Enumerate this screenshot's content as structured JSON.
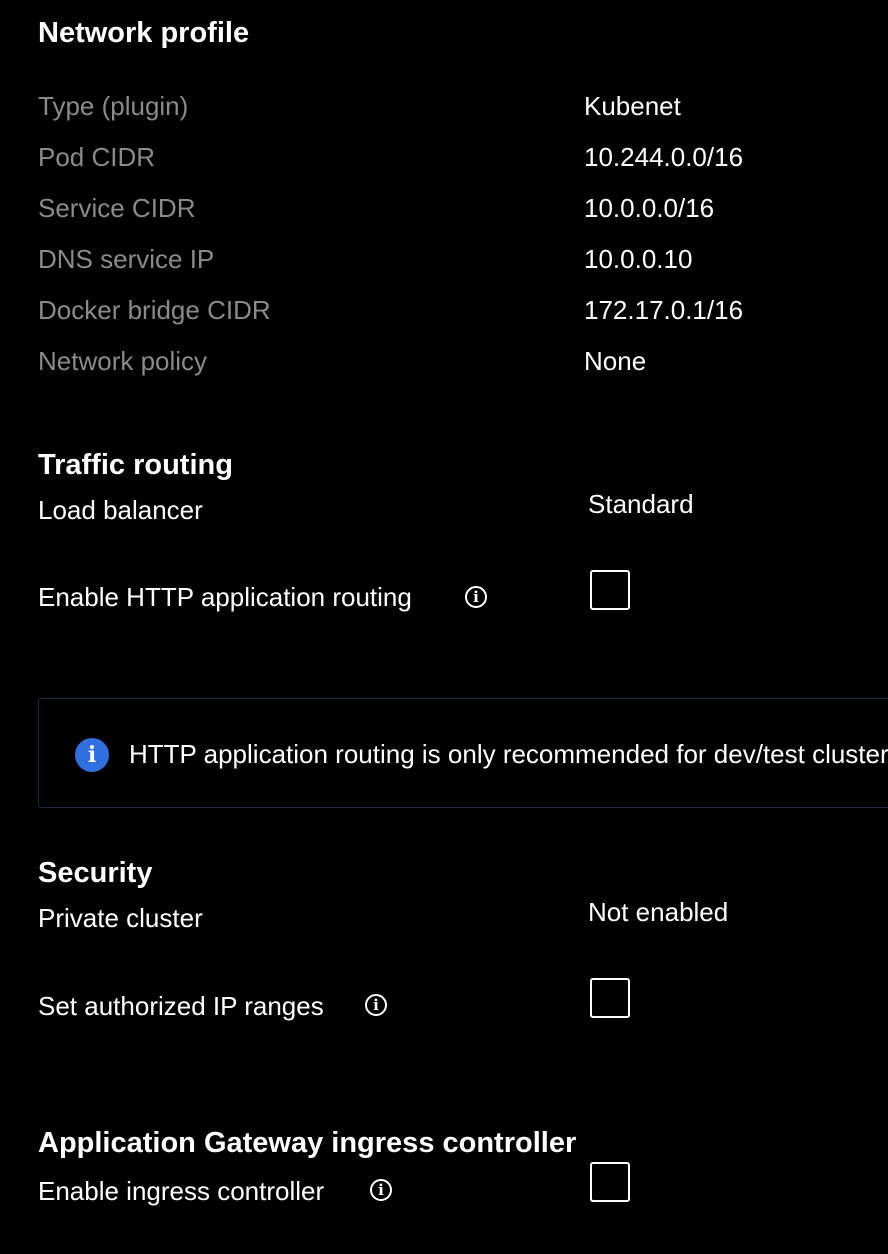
{
  "network_profile": {
    "title": "Network profile",
    "rows": [
      {
        "label": "Type (plugin)",
        "value": "Kubenet"
      },
      {
        "label": "Pod CIDR",
        "value": "10.244.0.0/16"
      },
      {
        "label": "Service CIDR",
        "value": "10.0.0.0/16"
      },
      {
        "label": "DNS service IP",
        "value": "10.0.0.10"
      },
      {
        "label": "Docker bridge CIDR",
        "value": "172.17.0.1/16"
      },
      {
        "label": "Network policy",
        "value": "None"
      }
    ]
  },
  "traffic_routing": {
    "title": "Traffic routing",
    "load_balancer_label": "Load balancer",
    "load_balancer_value": "Standard",
    "http_routing_label": "Enable HTTP application routing",
    "http_routing_checked": false,
    "info_banner_text": "HTTP application routing is only recommended for dev/test clusters"
  },
  "security": {
    "title": "Security",
    "private_cluster_label": "Private cluster",
    "private_cluster_value": "Not enabled",
    "authorized_ip_label": "Set authorized IP ranges",
    "authorized_ip_checked": false
  },
  "app_gateway": {
    "title": "Application Gateway ingress controller",
    "enable_label": "Enable ingress controller",
    "enable_checked": false
  },
  "icons": {
    "info": "info-icon",
    "banner_info": "info-filled-icon"
  },
  "colors": {
    "background": "#000000",
    "muted_label": "#8a8a8a",
    "text": "#ffffff",
    "info_blue": "#2f6fe0",
    "banner_border": "#1f2a44"
  }
}
